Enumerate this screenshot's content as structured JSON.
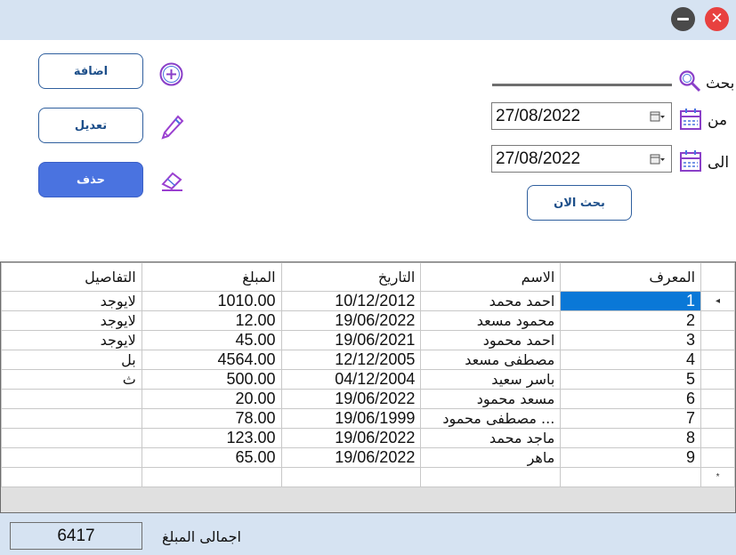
{
  "toolbar": {
    "add_label": "اضافة",
    "edit_label": "تعديل",
    "delete_label": "حذف"
  },
  "search": {
    "label": "بحث",
    "value": "",
    "from_label": "من",
    "to_label": "الى",
    "from_date": "27/08/2022",
    "to_date": "27/08/2022",
    "search_now_label": "بحث الان"
  },
  "table": {
    "columns": [
      "التفاصيل",
      "المبلغ",
      "التاريخ",
      "الاسم",
      "المعرف"
    ],
    "rows": [
      {
        "details": "لايوجد",
        "amount": "1010.00",
        "date": "10/12/2012",
        "name": "احمد محمد",
        "id": "1"
      },
      {
        "details": "لايوجد",
        "amount": "12.00",
        "date": "19/06/2022",
        "name": "محمود مسعد",
        "id": "2"
      },
      {
        "details": "لايوجد",
        "amount": "45.00",
        "date": "19/06/2021",
        "name": "احمد محمود",
        "id": "3"
      },
      {
        "details": "بل",
        "amount": "4564.00",
        "date": "12/12/2005",
        "name": "مصطفى مسعد",
        "id": "4"
      },
      {
        "details": "ث",
        "amount": "500.00",
        "date": "04/12/2004",
        "name": "باسر سعيد",
        "id": "5"
      },
      {
        "details": "",
        "amount": "20.00",
        "date": "19/06/2022",
        "name": "مسعد محمود",
        "id": "6"
      },
      {
        "details": "",
        "amount": "78.00",
        "date": "19/06/1999",
        "name": "مصطفى محمود ...",
        "id": "7"
      },
      {
        "details": "",
        "amount": "123.00",
        "date": "19/06/2022",
        "name": "ماجد محمد",
        "id": "8"
      },
      {
        "details": "",
        "amount": "65.00",
        "date": "19/06/2022",
        "name": "ماهر",
        "id": "9"
      }
    ],
    "current_row_marker": "◂",
    "new_row_marker": "*"
  },
  "footer": {
    "total_label": "اجمالى المبلغ",
    "total_value": "6417"
  },
  "colors": {
    "accent": "#4a73e0",
    "selection": "#0a78d7",
    "titlebar": "#d6e3f2",
    "close": "#e8413f"
  }
}
